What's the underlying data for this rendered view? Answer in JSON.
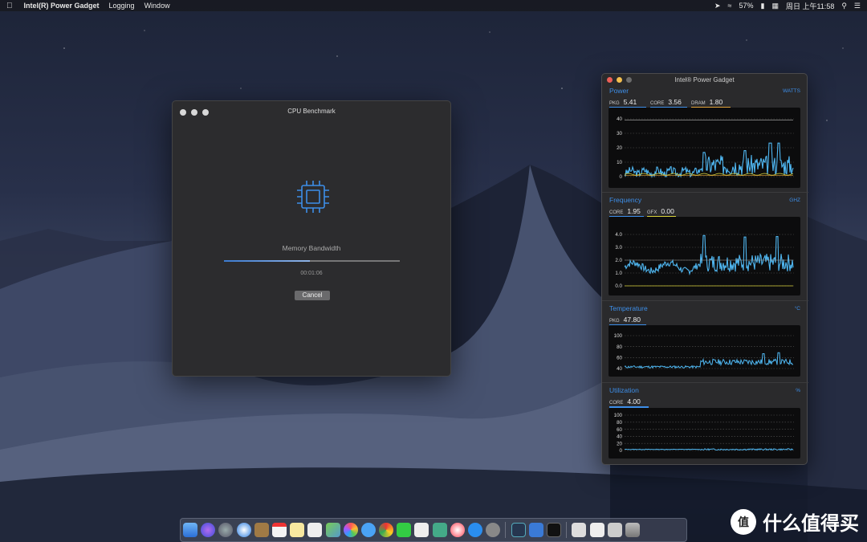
{
  "menubar": {
    "app": "Intel(R) Power Gadget",
    "items": [
      "Logging",
      "Window"
    ],
    "battery": "57%",
    "datetime": "周日 上午11:58"
  },
  "benchmark": {
    "title": "CPU Benchmark",
    "task": "Memory Bandwidth",
    "progress": 0.49,
    "elapsed": "00:01:06",
    "cancel_label": "Cancel"
  },
  "gadget": {
    "title": "Intel® Power Gadget",
    "power": {
      "title": "Power",
      "unit": "WATTS",
      "pkg_label": "PKG",
      "pkg": "5.41",
      "core_label": "CORE",
      "core": "3.56",
      "dram_label": "DRAM",
      "dram": "1.80",
      "ticks": [
        "40",
        "30",
        "20",
        "10",
        "0"
      ]
    },
    "frequency": {
      "title": "Frequency",
      "unit": "GHZ",
      "core_label": "CORE",
      "core": "1.95",
      "gfx_label": "GFX",
      "gfx": "0.00",
      "ticks": [
        "4.0",
        "3.0",
        "2.0",
        "1.0",
        "0.0"
      ]
    },
    "temperature": {
      "title": "Temperature",
      "unit": "°C",
      "pkg_label": "PKG",
      "pkg": "47.80",
      "ticks": [
        "100",
        "80",
        "60",
        "40"
      ]
    },
    "utilization": {
      "title": "Utilization",
      "unit": "%",
      "core_label": "CORE",
      "core": "4.00",
      "ticks": [
        "100",
        "80",
        "60",
        "40",
        "20",
        "0"
      ]
    }
  },
  "colors": {
    "accent": "#3d8ee8",
    "line_blue": "#4fb6f0",
    "line_yellow": "#d8d23a",
    "line_orange": "#e0a33a"
  },
  "watermark": "什么值得买"
}
